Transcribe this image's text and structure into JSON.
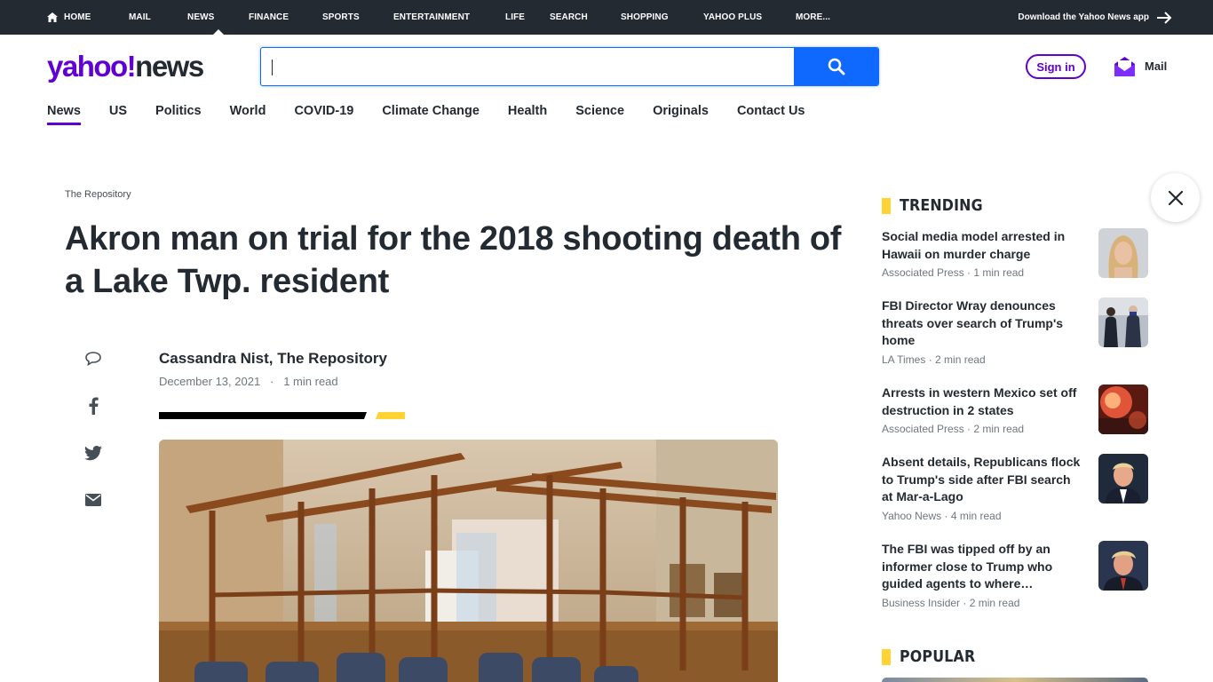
{
  "topnav": {
    "items": [
      "HOME",
      "MAIL",
      "NEWS",
      "FINANCE",
      "SPORTS",
      "ENTERTAINMENT",
      "LIFE",
      "SEARCH",
      "SHOPPING",
      "YAHOO PLUS",
      "MORE..."
    ],
    "active": "NEWS",
    "download": "Download the Yahoo News app"
  },
  "header": {
    "logo_yahoo": "yahoo!",
    "logo_news": "news",
    "search_value": "",
    "signin": "Sign in",
    "mail": "Mail"
  },
  "subnav": {
    "items": [
      "News",
      "US",
      "Politics",
      "World",
      "COVID-19",
      "Climate Change",
      "Health",
      "Science",
      "Originals",
      "Contact Us"
    ],
    "active": "News"
  },
  "article": {
    "source_small": "The Repository",
    "headline": "Akron man on trial for the 2018 shooting death of a Lake Twp. resident",
    "author": "Cassandra Nist, The Repository",
    "date": "December 13, 2021",
    "read_time": "1 min read"
  },
  "sidebar": {
    "trending_label": "TRENDING",
    "popular_label": "POPULAR",
    "trending": [
      {
        "title": "Social media model arrested in Hawaii on murder charge",
        "source": "Associated Press",
        "read": "1 min read"
      },
      {
        "title": "FBI Director Wray denounces threats over search of Trump's home",
        "source": "LA Times",
        "read": "2 min read"
      },
      {
        "title": "Arrests in western Mexico set off destruction in 2 states",
        "source": "Associated Press",
        "read": "2 min read"
      },
      {
        "title": "Absent details, Republicans flock to Trump's side after FBI search at Mar-a-Lago",
        "source": "Yahoo News",
        "read": "4 min read"
      },
      {
        "title": "The FBI was tipped off by an informer close to Trump who guided agents to where…",
        "source": "Business Insider",
        "read": "2 min read"
      }
    ]
  },
  "colors": {
    "topbar": "#232a31",
    "brand_purple": "#6001d2",
    "search_blue": "#0f69ff",
    "accent_yellow": "#ffd333"
  },
  "icons": {
    "home": "home-icon",
    "search": "search-icon",
    "mail": "mail-envelope-icon",
    "comment": "comment-icon",
    "facebook": "facebook-icon",
    "twitter": "twitter-icon",
    "email": "email-icon",
    "close": "close-icon",
    "arrow": "arrow-right-icon"
  }
}
